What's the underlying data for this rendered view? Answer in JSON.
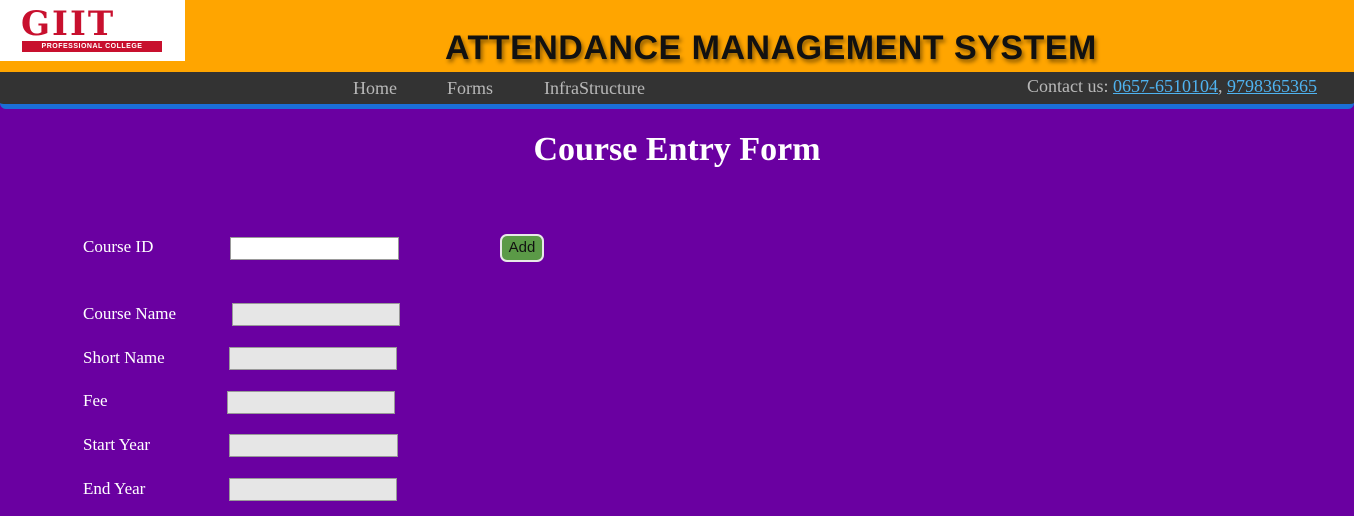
{
  "header": {
    "logo_text": "GIIT",
    "logo_subtext": "PROFESSIONAL COLLEGE",
    "title": "ATTENDANCE MANAGEMENT SYSTEM"
  },
  "nav": {
    "items": [
      {
        "label": "Home"
      },
      {
        "label": "Forms"
      },
      {
        "label": "InfraStructure"
      }
    ],
    "contact_label": "Contact us:",
    "phone_1": "0657-6510104",
    "phone_2": "9798365365"
  },
  "form": {
    "title": "Course Entry Form",
    "fields": [
      {
        "label": "Course ID",
        "value": ""
      },
      {
        "label": "Course Name",
        "value": ""
      },
      {
        "label": "Short Name",
        "value": ""
      },
      {
        "label": "Fee",
        "value": ""
      },
      {
        "label": "Start Year",
        "value": ""
      },
      {
        "label": "End Year",
        "value": ""
      }
    ],
    "add_label": "Add"
  },
  "colors": {
    "background": "#6a00a1",
    "header": "#ffa500",
    "navbar": "#333333",
    "nav_border": "#1a6fd8",
    "add_button": "#5b9a47",
    "link": "#4fb3f0"
  }
}
